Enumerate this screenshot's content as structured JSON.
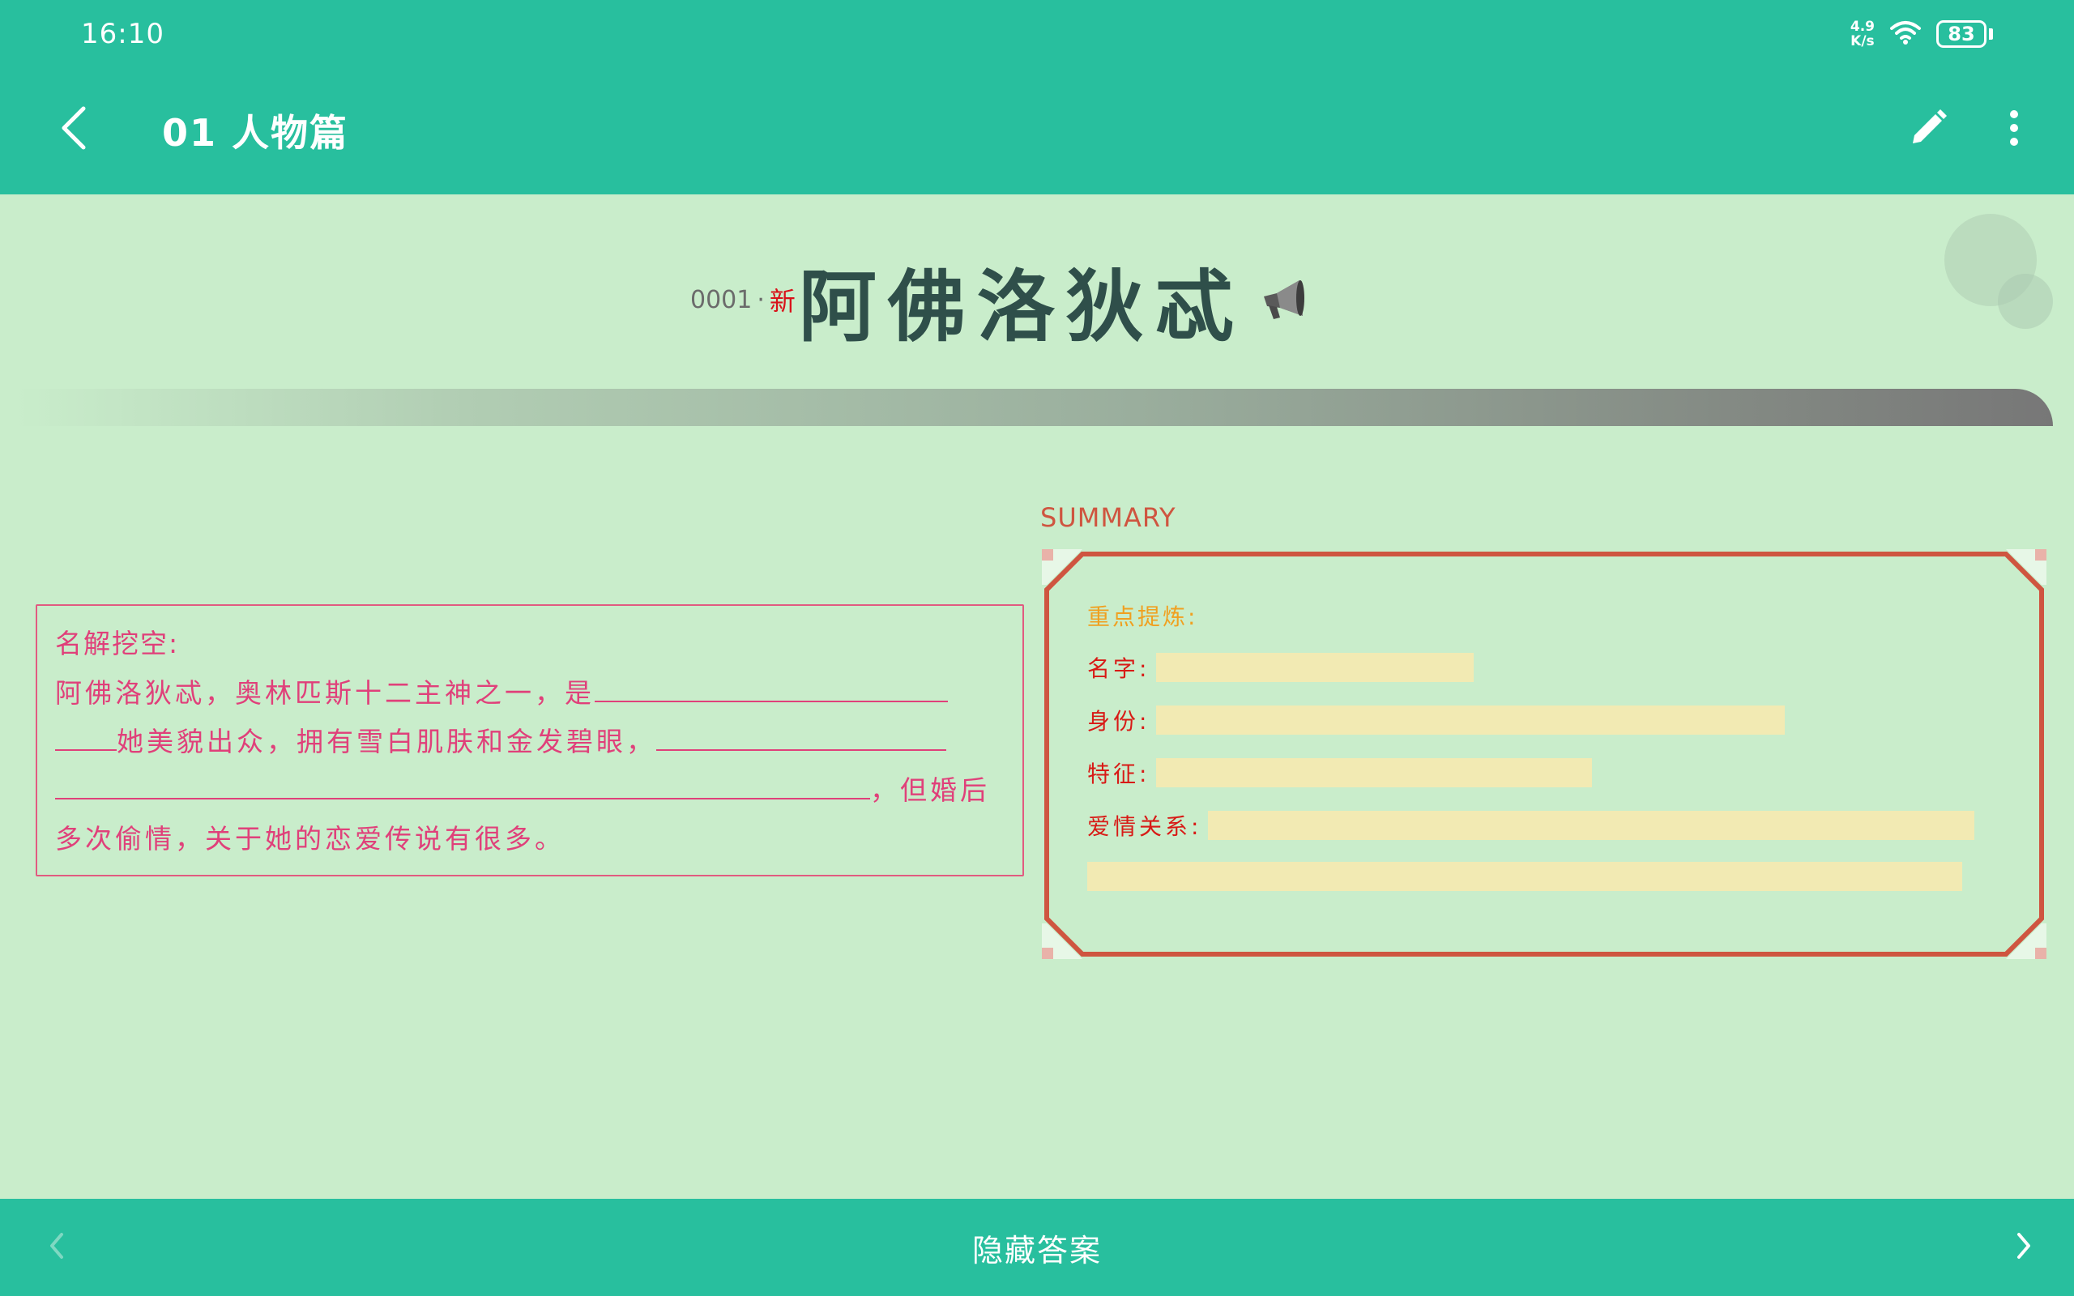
{
  "status_bar": {
    "time": "16:10",
    "net_speed_value": "4.9",
    "net_speed_unit": "K/s",
    "battery": "83"
  },
  "toolbar": {
    "title": "01 人物篇"
  },
  "word": {
    "index": "0001",
    "dot": "·",
    "new_badge": "新",
    "title": "阿佛洛狄忒"
  },
  "cloze": {
    "heading": "名解挖空:",
    "text_1": "阿佛洛狄忒，奥林匹斯十二主神之一，是",
    "text_2": "她美貌出众，拥有雪白肌肤和金发碧眼，",
    "text_3": "，但婚后多次偷情，关于她的恋爱传说有很多。"
  },
  "summary": {
    "label": "SUMMARY",
    "heading": "重点提炼:",
    "rows": [
      {
        "key": "名字:"
      },
      {
        "key": "身份:"
      },
      {
        "key": "特征:"
      },
      {
        "key": "爱情关系:"
      }
    ]
  },
  "bottom_bar": {
    "hide_answer_label": "隐藏答案"
  },
  "colors": {
    "primary": "#28bf9e",
    "background": "#c9edcb",
    "cloze_text": "#e0407a",
    "summary_border": "#cf5540",
    "answer_highlight": "#f2eab3"
  }
}
